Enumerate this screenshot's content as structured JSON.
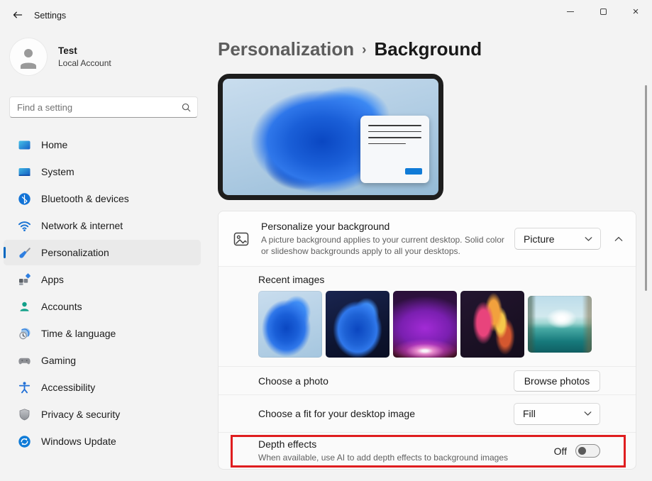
{
  "window": {
    "title": "Settings",
    "controls": [
      {
        "name": "minimize"
      },
      {
        "name": "maximize"
      },
      {
        "name": "close"
      }
    ]
  },
  "sidebar": {
    "user": {
      "name": "Test",
      "account_type": "Local Account"
    },
    "search": {
      "placeholder": "Find a setting"
    },
    "selected_index": 4,
    "items": [
      {
        "label": "Home",
        "icon": "home-icon"
      },
      {
        "label": "System",
        "icon": "system-icon"
      },
      {
        "label": "Bluetooth & devices",
        "icon": "bluetooth-icon"
      },
      {
        "label": "Network & internet",
        "icon": "network-icon"
      },
      {
        "label": "Personalization",
        "icon": "personalization-icon"
      },
      {
        "label": "Apps",
        "icon": "apps-icon"
      },
      {
        "label": "Accounts",
        "icon": "accounts-icon"
      },
      {
        "label": "Time & language",
        "icon": "time-language-icon"
      },
      {
        "label": "Gaming",
        "icon": "gaming-icon"
      },
      {
        "label": "Accessibility",
        "icon": "accessibility-icon"
      },
      {
        "label": "Privacy & security",
        "icon": "privacy-icon"
      },
      {
        "label": "Windows Update",
        "icon": "windows-update-icon"
      }
    ]
  },
  "main": {
    "breadcrumb": {
      "parent": "Personalization",
      "separator": "›",
      "current": "Background"
    },
    "preview": {
      "description": "Windows bloom wallpaper preview with sample window"
    },
    "personalize": {
      "title": "Personalize your background",
      "description": "A picture background applies to your current desktop. Solid color or slideshow backgrounds apply to all your desktops.",
      "dropdown_value": "Picture"
    },
    "recent_images": {
      "label": "Recent images",
      "images": [
        {
          "name": "windows-bloom-light",
          "style": "bloom-light"
        },
        {
          "name": "windows-bloom-dark",
          "style": "bloom-dark"
        },
        {
          "name": "purple-glow",
          "style": "purple-glow"
        },
        {
          "name": "abstract-ribbons",
          "style": "ribbons"
        },
        {
          "name": "river-sunrise",
          "style": "river"
        }
      ]
    },
    "choose_photo": {
      "label": "Choose a photo",
      "button_label": "Browse photos"
    },
    "choose_fit": {
      "label": "Choose a fit for your desktop image",
      "dropdown_value": "Fill"
    },
    "depth_effects": {
      "title": "Depth effects",
      "description": "When available, use AI to add depth effects to background images",
      "toggle_label": "Off",
      "toggle_state": "off"
    }
  },
  "annotation": {
    "shape": "highlight-box",
    "color": "#df1d1f"
  },
  "colors": {
    "accent": "#0067c0",
    "window_bg": "#f3f3f3",
    "card_bg": "#fbfbfb",
    "selected_item_bg": "#eaeaea"
  }
}
